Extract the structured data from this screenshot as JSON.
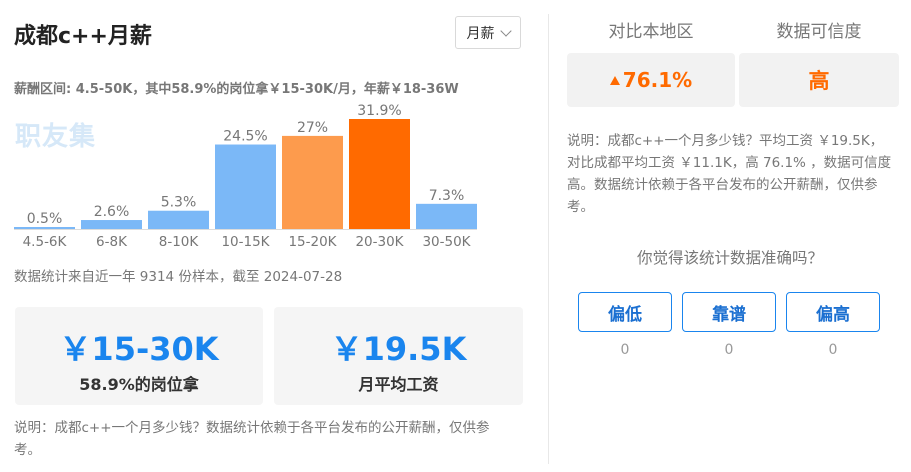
{
  "left_panel": {
    "title": "成都c++月薪",
    "period_select": {
      "selected": "月薪"
    },
    "range_summary": "薪酬区间: 4.5-50K，其中58.9%的岗位拿￥15-30K/月，年薪￥18-36W",
    "watermark": "职友集",
    "stat_note": "数据统计来自近一年 9314 份样本，截至 2024-07-28",
    "cards": [
      {
        "value": "￥15-30K",
        "label": "58.9%的岗位拿"
      },
      {
        "value": "￥19.5K",
        "label": "月平均工资"
      }
    ],
    "note": "说明：成都c++一个月多少钱？数据统计依赖于各平台发布的公开薪酬，仅供参考。"
  },
  "chart_data": {
    "type": "bar",
    "categories": [
      "4.5-6K",
      "6-8K",
      "8-10K",
      "10-15K",
      "15-20K",
      "20-30K",
      "30-50K"
    ],
    "values": [
      0.5,
      2.6,
      5.3,
      24.5,
      27,
      31.9,
      7.3
    ],
    "value_labels": [
      "0.5%",
      "2.6%",
      "5.3%",
      "24.5%",
      "27%",
      "31.9%",
      "7.3%"
    ],
    "bar_colors": [
      "#7bb8f7",
      "#7bb8f7",
      "#7bb8f7",
      "#7bb8f7",
      "#fd9b4d",
      "#ff6a00",
      "#7bb8f7"
    ],
    "ylim": [
      0,
      31.9
    ],
    "grid": false
  },
  "right_panel": {
    "headers": [
      "对比本地区",
      "数据可信度"
    ],
    "compare_value": "76.1%",
    "compare_direction_icon": "arrow-up-icon",
    "credibility_value": "高",
    "note": "说明：成都c++一个月多少钱？平均工资 ￥19.5K，对比成都平均工资 ￥11.1K，高 76.1% ，数据可信度高。数据统计依赖于各平台发布的公开薪酬，仅供参考。",
    "question": "你觉得该统计数据准确吗？",
    "votes": [
      {
        "label": "偏低",
        "count": "0"
      },
      {
        "label": "靠谱",
        "count": "0"
      },
      {
        "label": "偏高",
        "count": "0"
      }
    ]
  },
  "colors": {
    "accent_blue": "#1a85ee",
    "accent_orange": "#ff6a00",
    "bar_blue": "#7bb8f7",
    "bar_light_orange": "#fd9b4d"
  }
}
